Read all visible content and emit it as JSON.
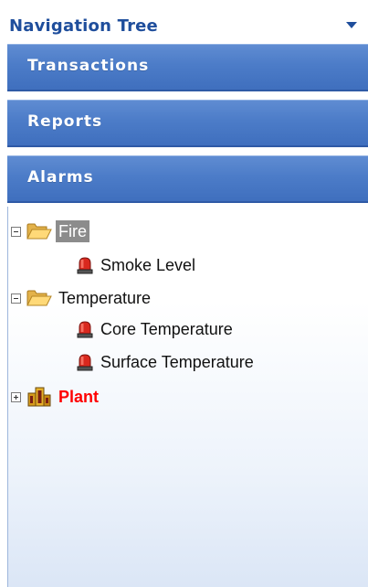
{
  "header": {
    "title": "Navigation Tree",
    "dropdown_icon": "triangle-down-icon",
    "title_color": "#1f4e9c"
  },
  "sections": [
    {
      "label": "Transactions"
    },
    {
      "label": "Reports"
    },
    {
      "label": "Alarms"
    }
  ],
  "tree": {
    "nodes": [
      {
        "label": "Fire",
        "type": "folder",
        "expanded": true,
        "selected": true
      },
      {
        "label": "Smoke Level",
        "type": "alarm"
      },
      {
        "label": "Temperature",
        "type": "folder",
        "expanded": true
      },
      {
        "label": "Core Temperature",
        "type": "alarm"
      },
      {
        "label": "Surface Temperature",
        "type": "alarm"
      },
      {
        "label": "Plant",
        "type": "plant",
        "expanded": false,
        "label_color": "#ff0000"
      }
    ]
  },
  "colors": {
    "bar_top": "#5f8cd2",
    "bar_bottom": "#3f6fbe",
    "selected_bg": "#8c8c8c"
  }
}
